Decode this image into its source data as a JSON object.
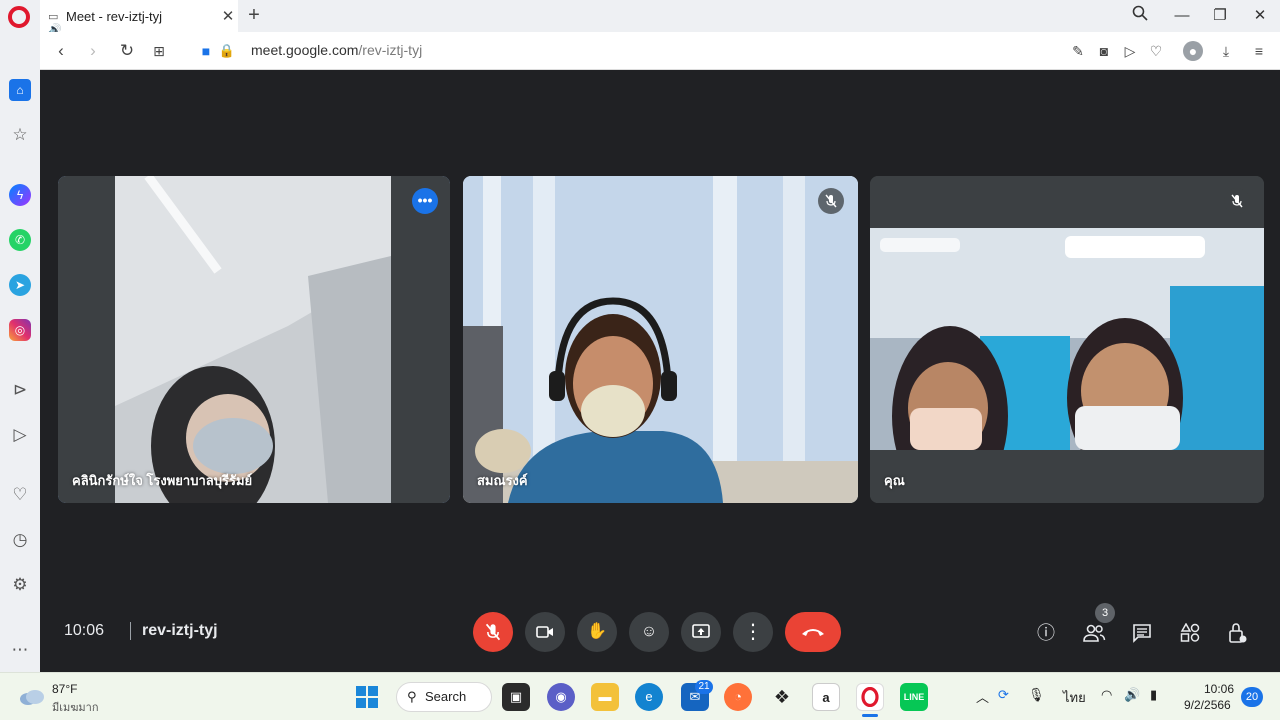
{
  "browser": {
    "tab_title": "Meet - rev-iztj-tyj",
    "tab_close": "✕",
    "new_tab": "+",
    "url_host": "meet.google.com",
    "url_path": "/rev-iztj-tyj"
  },
  "meeting": {
    "time": "10:06",
    "code": "rev-iztj-tyj",
    "participant_count": "3",
    "participants": [
      {
        "name": "คลินิกรักษ์ใจ โรงพยาบาลบุรีรัมย์",
        "speaking": true,
        "muted": false
      },
      {
        "name": "สมณรงค์",
        "speaking": false,
        "muted": true
      },
      {
        "name": "คุณ",
        "speaking": false,
        "muted": true
      }
    ]
  },
  "taskbar": {
    "weather_temp": "87°F",
    "weather_desc": "มีเมฆมาก",
    "search_label": "Search",
    "mail_badge": "21",
    "language": "ไทย",
    "clock_time": "10:06",
    "clock_date": "9/2/2566",
    "notification_count": "20"
  },
  "colors": {
    "meet_bg": "#202124",
    "accent_blue": "#1a73e8",
    "active_outline": "#8ab4f8",
    "end_call_red": "#ea4335",
    "opera_red": "#e0182d"
  }
}
